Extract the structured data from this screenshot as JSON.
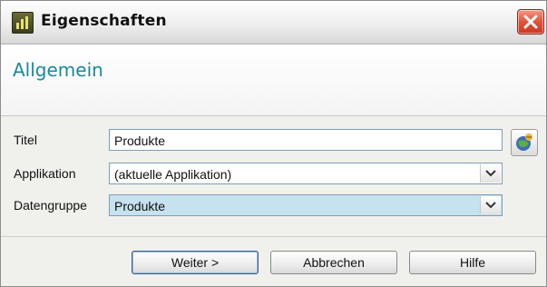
{
  "window": {
    "title": "Eigenschaften",
    "app_icon": "application-icon",
    "close_icon": "close-icon"
  },
  "header": {
    "title": "Allgemein"
  },
  "form": {
    "titel": {
      "label": "Titel",
      "value": "Produkte"
    },
    "applikation": {
      "label": "Applikation",
      "value": "(aktuelle Applikation)"
    },
    "datengruppe": {
      "label": "Datengruppe",
      "value": "Produkte"
    }
  },
  "buttons": {
    "next": "Weiter >",
    "cancel": "Abbrechen",
    "help": "Hilfe"
  },
  "colors": {
    "header_title": "#1a8a9c",
    "selected_field": "#c6e2ee",
    "close_button": "#e0533a"
  }
}
